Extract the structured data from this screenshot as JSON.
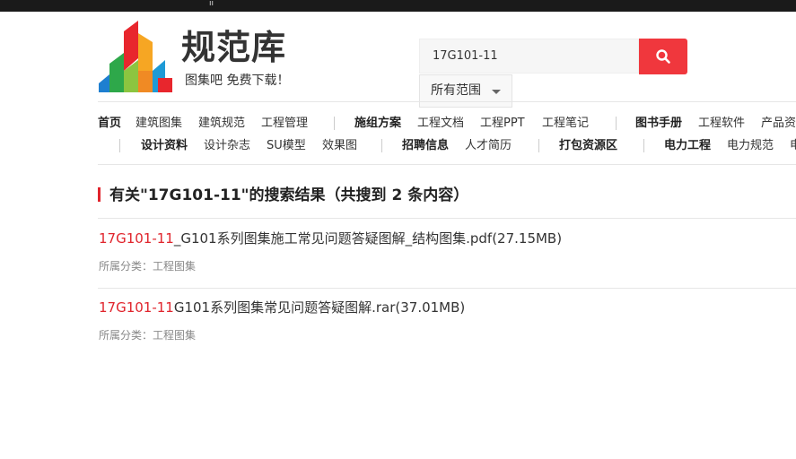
{
  "site": {
    "logo_text": "规范库",
    "slogan": "图集吧 免费下载！",
    "colors": {
      "brand_red": "#e0242c",
      "search_btn": "#f0373d"
    }
  },
  "search": {
    "query": "17G101-11",
    "button_icon": "search-icon",
    "scope_label": "所有范围"
  },
  "nav": {
    "row1": [
      {
        "label": "首页",
        "bold": true
      },
      {
        "label": "建筑图集",
        "bold": false
      },
      {
        "label": "建筑规范",
        "bold": false
      },
      {
        "label": "工程管理",
        "bold": false
      },
      {
        "label": "施组方案",
        "bold": true
      },
      {
        "label": "工程文档",
        "bold": false
      },
      {
        "label": "工程PPT",
        "bold": false
      },
      {
        "label": "工程笔记",
        "bold": false
      },
      {
        "label": "图书手册",
        "bold": true
      },
      {
        "label": "工程软件",
        "bold": false
      },
      {
        "label": "产品资",
        "bold": false
      }
    ],
    "row2": [
      {
        "label": "设计资料",
        "bold": true
      },
      {
        "label": "设计杂志",
        "bold": false
      },
      {
        "label": "SU模型",
        "bold": false
      },
      {
        "label": "效果图",
        "bold": false
      },
      {
        "label": "招聘信息",
        "bold": true
      },
      {
        "label": "人才简历",
        "bold": false
      },
      {
        "label": "打包资源区",
        "bold": true
      },
      {
        "label": "电力工程",
        "bold": true
      },
      {
        "label": "电力规范",
        "bold": false
      },
      {
        "label": "电",
        "bold": false
      }
    ]
  },
  "results": {
    "heading": "有关\"17G101-11\"的搜索结果（共搜到 2 条内容）",
    "items": [
      {
        "highlight": "17G101-11",
        "rest": "_G101系列图集施工常见问题答疑图解_结构图集.pdf(27.15MB)",
        "category": "所属分类：工程图集"
      },
      {
        "highlight": "17G101-11",
        "rest": "G101系列图集常见问题答疑图解.rar(37.01MB)",
        "category": "所属分类：工程图集"
      }
    ]
  }
}
